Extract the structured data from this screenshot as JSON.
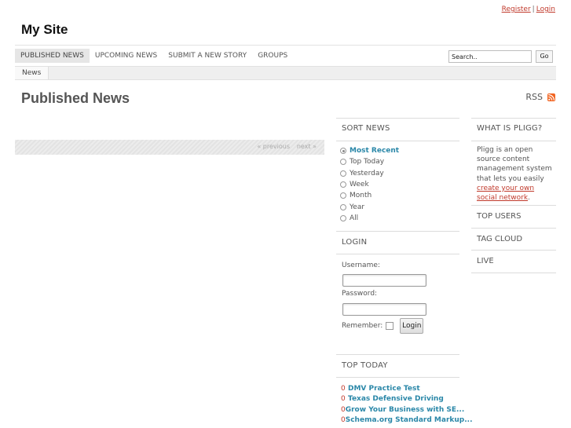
{
  "header": {
    "register_label": "Register",
    "separator": "|",
    "login_label": "Login",
    "site_title": "My Site"
  },
  "nav": {
    "items": [
      {
        "label": "PUBLISHED NEWS"
      },
      {
        "label": "UPCOMING NEWS"
      },
      {
        "label": "SUBMIT A NEW STORY"
      },
      {
        "label": "GROUPS"
      }
    ],
    "search_value": "Search..",
    "go_label": "Go"
  },
  "subnav": {
    "items": [
      {
        "label": "News"
      }
    ]
  },
  "main": {
    "heading": "Published News",
    "rss_label": "RSS",
    "pager": {
      "previous_label": "« previous",
      "next_label": "next »"
    }
  },
  "sort_news": {
    "title": "SORT NEWS",
    "options": [
      {
        "label": "Most Recent"
      },
      {
        "label": "Top Today"
      },
      {
        "label": "Yesterday"
      },
      {
        "label": "Week"
      },
      {
        "label": "Month"
      },
      {
        "label": "Year"
      },
      {
        "label": "All"
      }
    ]
  },
  "login_box": {
    "title": "LOGIN",
    "username_label": "Username:",
    "password_label": "Password:",
    "remember_label": "Remember:",
    "submit_label": "Login"
  },
  "top_today": {
    "title": "TOP TODAY",
    "stories": [
      {
        "count": "0",
        "title": "DMV Practice Test"
      },
      {
        "count": "0",
        "title": "Texas Defensive Driving"
      },
      {
        "count": "0",
        "title": "Grow Your Business with SE..."
      },
      {
        "count": "0",
        "title": "Schema.org Standard Markup..."
      }
    ]
  },
  "what_is": {
    "title": "WHAT IS PLIGG?",
    "text": "Pligg is an open source content management system that lets you easily",
    "link_text": "create your own social network",
    "end": "."
  },
  "right_links": {
    "top_users": "TOP USERS",
    "tag_cloud": "TAG CLOUD",
    "live": "LIVE"
  },
  "colors": {
    "accent_link": "#2a87a8",
    "red_link": "#c0392b",
    "rss_orange": "#f26522"
  }
}
